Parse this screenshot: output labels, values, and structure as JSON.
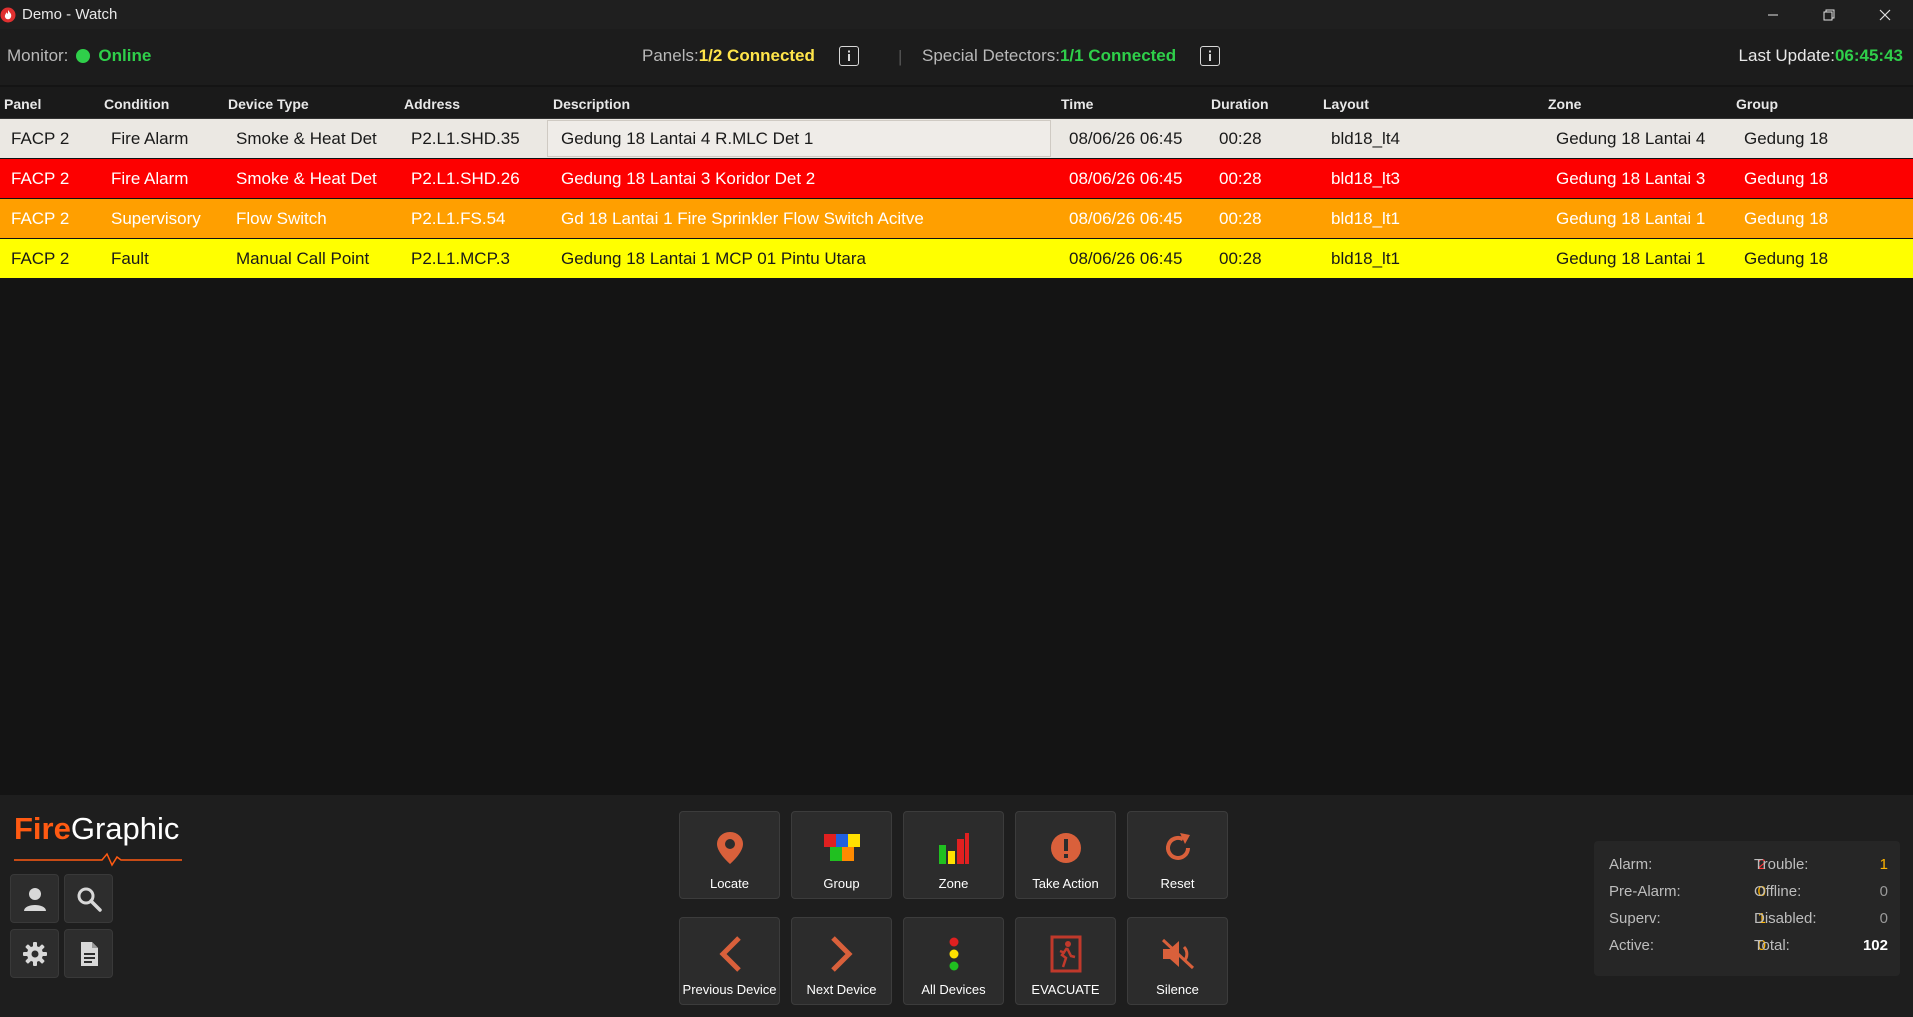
{
  "window": {
    "title": "Demo - Watch",
    "minimize_glyph": "—",
    "restore_glyph": "❐",
    "close_glyph": "✕"
  },
  "status": {
    "monitor_label": "Monitor:",
    "monitor_value": "Online",
    "panels_label": "Panels:",
    "panels_value": "1/2 Connected",
    "separator": "|",
    "special_label": "Special Detectors:",
    "special_value": "1/1 Connected",
    "update_label": "Last Update:",
    "update_value": "06:45:43",
    "colors": {
      "online": "#2fcf4a",
      "panels": "#ffe54a",
      "special": "#2fcf4a"
    }
  },
  "table": {
    "headers": [
      "Panel",
      "Condition",
      "Device Type",
      "Address",
      "Description",
      "Time",
      "Duration",
      "Layout",
      "Zone",
      "Group"
    ],
    "rows": [
      {
        "panel": "FACP 2",
        "condition": "Fire Alarm",
        "device_type": "Smoke & Heat Det",
        "address": "P2.L1.SHD.35",
        "description": "Gedung 18 Lantai 4 R.MLC Det 1",
        "time": "08/06/26 06:45",
        "duration": "00:28",
        "layout": "bld18_lt4",
        "zone": "Gedung 18 Lantai 4",
        "group": "Gedung 18",
        "color": "#ebe8e3"
      },
      {
        "panel": "FACP 2",
        "condition": "Fire Alarm",
        "device_type": "Smoke & Heat Det",
        "address": "P2.L1.SHD.26",
        "description": "Gedung 18 Lantai 3 Koridor Det 2",
        "time": "08/06/26 06:45",
        "duration": "00:28",
        "layout": "bld18_lt3",
        "zone": "Gedung 18 Lantai 3",
        "group": "Gedung 18",
        "color": "#fd0000"
      },
      {
        "panel": "FACP 2",
        "condition": "Supervisory",
        "device_type": "Flow Switch",
        "address": "P2.L1.FS.54",
        "description": "Gd 18 Lantai 1 Fire Sprinkler Flow Switch Acitve",
        "time": "08/06/26 06:45",
        "duration": "00:28",
        "layout": "bld18_lt1",
        "zone": "Gedung 18 Lantai 1",
        "group": "Gedung 18",
        "color": "#ff9f00"
      },
      {
        "panel": "FACP 2",
        "condition": "Fault",
        "device_type": "Manual Call Point",
        "address": "P2.L1.MCP.3",
        "description": "Gedung 18 Lantai 1 MCP 01 Pintu Utara",
        "time": "08/06/26 06:45",
        "duration": "00:28",
        "layout": "bld18_lt1",
        "zone": "Gedung 18 Lantai 1",
        "group": "Gedung 18",
        "color": "#ffff00"
      }
    ]
  },
  "logo": {
    "fire": "Fire",
    "graphic": "Graphic"
  },
  "tools": [
    "user-icon",
    "search-icon",
    "gear-icon",
    "document-icon"
  ],
  "actions": {
    "locate": "Locate",
    "group": "Group",
    "zone": "Zone",
    "take_action": "Take Action",
    "reset": "Reset",
    "previous_device": "Previous Device",
    "next_device": "Next Device",
    "all_devices": "All Devices",
    "evacuate": "EVACUATE",
    "silence": "Silence",
    "icon_color": "#d9603b"
  },
  "counts": {
    "alarm_label": "Alarm:",
    "alarm": "2",
    "trouble_label": "Trouble:",
    "trouble": "1",
    "prealarm_label": "Pre-Alarm:",
    "prealarm": "0",
    "offline_label": "Offline:",
    "offline": "0",
    "superv_label": "Superv:",
    "superv": "1",
    "disabled_label": "Disabled:",
    "disabled": "0",
    "active_label": "Active:",
    "active": "0",
    "total_label": "Total:",
    "total": "102"
  }
}
